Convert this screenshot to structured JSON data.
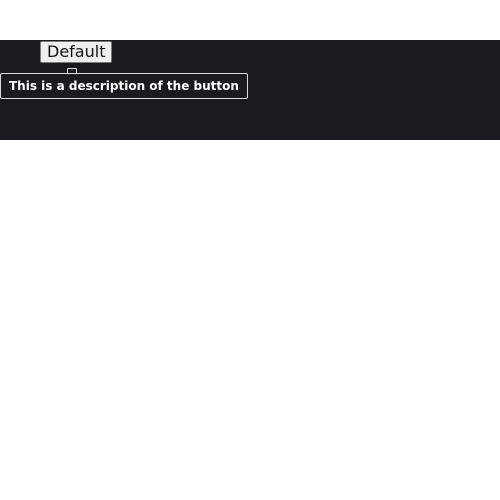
{
  "button": {
    "label": "Default"
  },
  "tooltip": {
    "text": "This is a description of the button"
  },
  "colors": {
    "background": "#ffffff",
    "panel": "#1b1b1f",
    "tooltip_border": "#d9d9d9",
    "button_bg": "#efefef"
  }
}
